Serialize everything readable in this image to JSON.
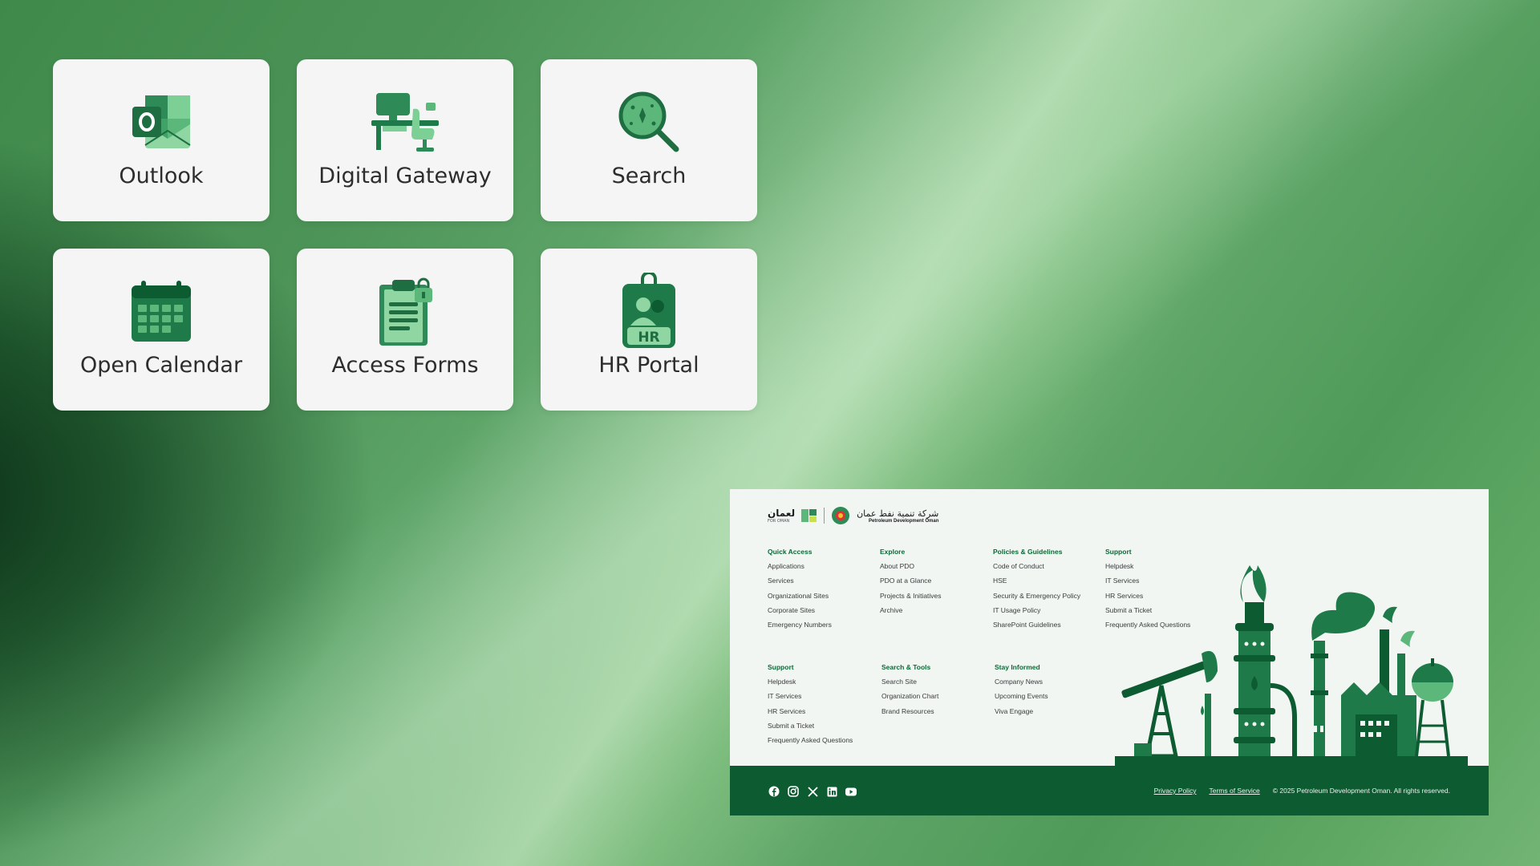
{
  "tiles": [
    {
      "label": "Outlook",
      "icon": "outlook-icon"
    },
    {
      "label": "Digital Gateway",
      "icon": "desk-icon"
    },
    {
      "label": "Search",
      "icon": "magnifier-icon"
    },
    {
      "label": "Open Calendar",
      "icon": "calendar-icon"
    },
    {
      "label": "Access Forms",
      "icon": "clipboard-icon"
    },
    {
      "label": "HR Portal",
      "icon": "hr-badge-icon"
    }
  ],
  "footer": {
    "logo": {
      "for_oman_ar": "لعمان",
      "for_oman_en": "FOR OMAN",
      "pdo_ar": "شركة تنمية نفط عمان",
      "pdo_en": "Petroleum Development Oman"
    },
    "columns_top": [
      {
        "heading": "Quick Access",
        "items": [
          "Applications",
          "Services",
          "Organizational Sites",
          "Corporate Sites",
          "Emergency Numbers"
        ]
      },
      {
        "heading": "Explore",
        "items": [
          "About PDO",
          "PDO at a Glance",
          "Projects & Initiatives",
          "Archive"
        ]
      },
      {
        "heading": "Policies & Guidelines",
        "items": [
          "Code of Conduct",
          "HSE",
          "Security & Emergency Policy",
          "IT Usage Policy",
          "SharePoint Guidelines"
        ]
      },
      {
        "heading": "Support",
        "items": [
          "Helpdesk",
          "IT Services",
          "HR Services",
          "Submit a Ticket",
          "Frequently Asked Questions"
        ]
      }
    ],
    "columns_bottom": [
      {
        "heading": "Support",
        "items": [
          "Helpdesk",
          "IT Services",
          "HR Services",
          "Submit a Ticket",
          "Frequently Asked Questions"
        ]
      },
      {
        "heading": "Search & Tools",
        "items": [
          "Search Site",
          "Organization Chart",
          "Brand Resources"
        ]
      },
      {
        "heading": "Stay Informed",
        "items": [
          "Company News",
          "Upcoming Events",
          "Viva Engage"
        ]
      }
    ],
    "social": [
      "facebook-icon",
      "instagram-icon",
      "x-icon",
      "linkedin-icon",
      "youtube-icon"
    ],
    "privacy": "Privacy Policy",
    "terms": "Terms of Service",
    "copyright": "© 2025 Petroleum Development Oman. All rights reserved."
  },
  "colors": {
    "brand_dark": "#0d5b31",
    "brand": "#1b7a45",
    "brand_light": "#5cb87a"
  }
}
